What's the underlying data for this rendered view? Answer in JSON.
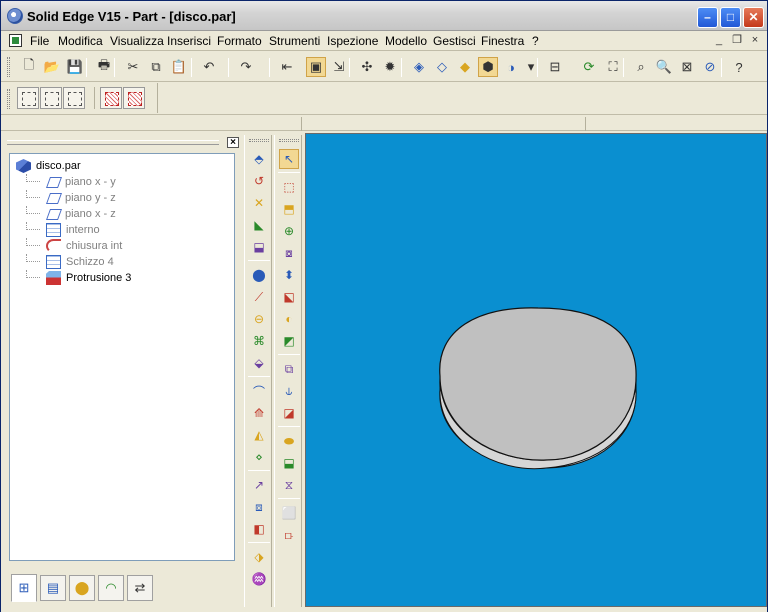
{
  "window": {
    "title": "Solid Edge V15 - Part - [disco.par]",
    "controls": {
      "minimize": "–",
      "maximize": "□",
      "close": "✕"
    }
  },
  "menubar": {
    "items": [
      "File",
      "Modifica",
      "Visualizza",
      "Inserisci",
      "Formato",
      "Strumenti",
      "Ispezione",
      "Modello",
      "Gestisci",
      "Finestra",
      "?"
    ],
    "mdi_controls": {
      "minimize": "_",
      "restore": "❐",
      "close": "×"
    }
  },
  "main_toolbar": {
    "buttons": [
      {
        "name": "new-icon",
        "glyph": "🗋"
      },
      {
        "name": "open-icon",
        "glyph": "📂"
      },
      {
        "name": "save-icon",
        "glyph": "💾"
      },
      {
        "name": "print-icon",
        "glyph": "🖶"
      },
      {
        "name": "cut-icon",
        "glyph": "✂"
      },
      {
        "name": "copy-icon",
        "glyph": "⧉"
      },
      {
        "name": "paste-icon",
        "glyph": "📋"
      },
      {
        "name": "undo-icon",
        "glyph": "↶"
      },
      {
        "name": "redo-icon",
        "glyph": "↷"
      },
      {
        "name": "insert-object-icon",
        "glyph": "⇤"
      },
      {
        "name": "sketch-mode-icon",
        "glyph": "▣"
      },
      {
        "name": "pathfinder-icon",
        "glyph": "⇲"
      },
      {
        "name": "select-tools-icon",
        "glyph": "✣"
      },
      {
        "name": "color-icon",
        "glyph": "✹"
      },
      {
        "name": "view-iso-icon",
        "glyph": "◈"
      },
      {
        "name": "view-dim-icon",
        "glyph": "◇"
      },
      {
        "name": "view-yellow-icon",
        "glyph": "◆"
      },
      {
        "name": "shaded-icon",
        "glyph": "⬢"
      },
      {
        "name": "sphere-icon",
        "glyph": "◑"
      },
      {
        "name": "view-dropdown-icon",
        "glyph": "▾"
      },
      {
        "name": "hide-icon",
        "glyph": "⊟"
      },
      {
        "name": "rotate-icon",
        "glyph": "⟳"
      },
      {
        "name": "fit-icon",
        "glyph": "⛶"
      },
      {
        "name": "zoom-area-icon",
        "glyph": "⌕"
      },
      {
        "name": "zoom-icon",
        "glyph": "🔍"
      },
      {
        "name": "fit-window-icon",
        "glyph": "⊠"
      },
      {
        "name": "spin-icon",
        "glyph": "⊘"
      },
      {
        "name": "help-icon",
        "glyph": "?"
      }
    ]
  },
  "pathfinder": {
    "close": "×",
    "items": [
      {
        "label": "disco.par",
        "icon": "part",
        "dim": false
      },
      {
        "label": "piano x - y",
        "icon": "plane",
        "dim": true
      },
      {
        "label": "piano y - z",
        "icon": "plane",
        "dim": true
      },
      {
        "label": "piano x - z",
        "icon": "plane",
        "dim": true
      },
      {
        "label": "interno",
        "icon": "grid",
        "dim": true
      },
      {
        "label": "chiusura int",
        "icon": "curve",
        "dim": true
      },
      {
        "label": "Schizzo 4",
        "icon": "sketch",
        "dim": true
      },
      {
        "label": "Protrusione 3",
        "icon": "protrusion",
        "dim": false
      }
    ],
    "tabs": [
      "feature-pathfinder",
      "layers",
      "sensors",
      "features-library",
      "relationships"
    ]
  },
  "features_toolbar": {
    "left": [
      "⬘",
      "↺",
      "✕",
      "◣",
      "⬓",
      "⬤",
      "⟋",
      "⊖",
      "⌘",
      "⬙",
      "⌒",
      "⟰",
      "◭",
      "⋄",
      "↗",
      "⧈",
      "◧",
      "⬗",
      "♒"
    ],
    "right": [
      "↖",
      "⬚",
      "⬒",
      "⊕",
      "⧇",
      "⬍",
      "⬕",
      "◐",
      "◩",
      "⧉",
      "⫝",
      "◪",
      "⬬",
      "⬓",
      "⧖",
      "⬜",
      "⟥"
    ]
  },
  "model": {
    "shape": "disc",
    "background": "#0a8fd0",
    "face_color": "#c0c0c0",
    "side_color": "#d6d6d6"
  }
}
